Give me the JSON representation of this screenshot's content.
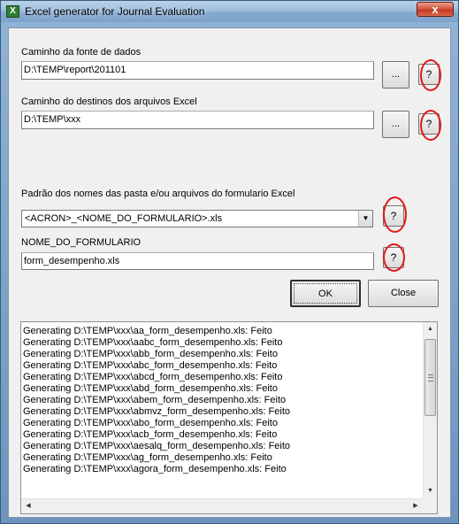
{
  "window": {
    "title": "Excel generator for Journal Evaluation",
    "close_glyph": "x",
    "icon": "excel-app-icon"
  },
  "source": {
    "label": "Caminho da fonte de dados",
    "value": "D:\\TEMP\\report\\201101",
    "browse_label": "...",
    "help_label": "?"
  },
  "dest": {
    "label": "Caminho do destinos dos arquivos Excel",
    "value": "D:\\TEMP\\xxx",
    "browse_label": "...",
    "help_label": "?"
  },
  "pattern": {
    "label": "Padrão dos nomes das pasta e/ou arquivos do formulario Excel",
    "selected": "<ACRON>_<NOME_DO_FORMULARIO>.xls",
    "arrow_glyph": "▼",
    "help_label": "?"
  },
  "form": {
    "label": "NOME_DO_FORMULARIO",
    "value": "form_desempenho.xls",
    "help_label": "?"
  },
  "buttons": {
    "ok": "OK",
    "close": "Close"
  },
  "log": {
    "lines": [
      "Generating D:\\TEMP\\xxx\\aa_form_desempenho.xls: Feito",
      "Generating D:\\TEMP\\xxx\\aabc_form_desempenho.xls: Feito",
      "Generating D:\\TEMP\\xxx\\abb_form_desempenho.xls: Feito",
      "Generating D:\\TEMP\\xxx\\abc_form_desempenho.xls: Feito",
      "Generating D:\\TEMP\\xxx\\abcd_form_desempenho.xls: Feito",
      "Generating D:\\TEMP\\xxx\\abd_form_desempenho.xls: Feito",
      "Generating D:\\TEMP\\xxx\\abem_form_desempenho.xls: Feito",
      "Generating D:\\TEMP\\xxx\\abmvz_form_desempenho.xls: Feito",
      "Generating D:\\TEMP\\xxx\\abo_form_desempenho.xls: Feito",
      "Generating D:\\TEMP\\xxx\\acb_form_desempenho.xls: Feito",
      "Generating D:\\TEMP\\xxx\\aesalq_form_desempenho.xls: Feito",
      "Generating D:\\TEMP\\xxx\\ag_form_desempenho.xls: Feito",
      "Generating D:\\TEMP\\xxx\\agora_form_desempenho.xls: Feito"
    ],
    "scroll_up": "▲",
    "scroll_down": "▼",
    "scroll_left": "◀",
    "scroll_right": "▶"
  },
  "colors": {
    "help_highlight": "#e01818",
    "close_button": "#c23b22"
  }
}
